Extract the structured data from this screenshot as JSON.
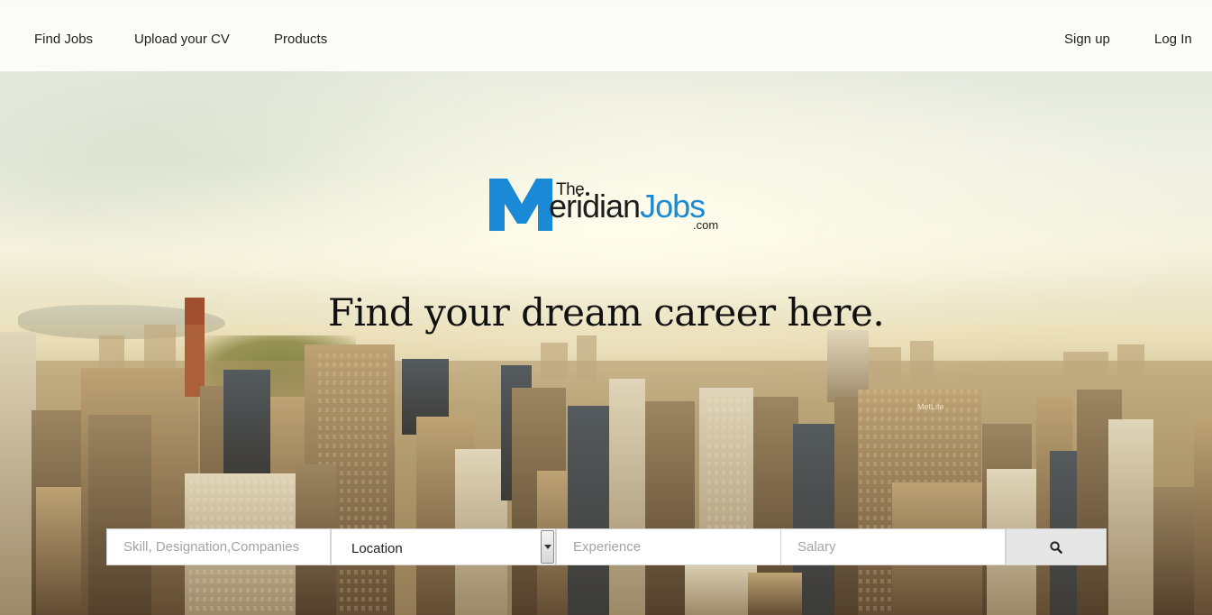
{
  "nav": {
    "left": [
      {
        "label": "Find Jobs"
      },
      {
        "label": "Upload your CV"
      },
      {
        "label": "Products"
      }
    ],
    "right": [
      {
        "label": "Sign up"
      },
      {
        "label": "Log In"
      }
    ]
  },
  "logo": {
    "the": "The",
    "wordmark_main": "eridian",
    "wordmark_accent": "Jobs",
    "domain": ".com",
    "brand_blue": "#1b8ad6"
  },
  "hero": {
    "headline": "Find your dream career here."
  },
  "search": {
    "keyword_placeholder": "Skill, Designation,Companies",
    "location_value": "Location",
    "experience_placeholder": "Experience",
    "salary_placeholder": "Salary",
    "button_icon": "search-icon"
  }
}
